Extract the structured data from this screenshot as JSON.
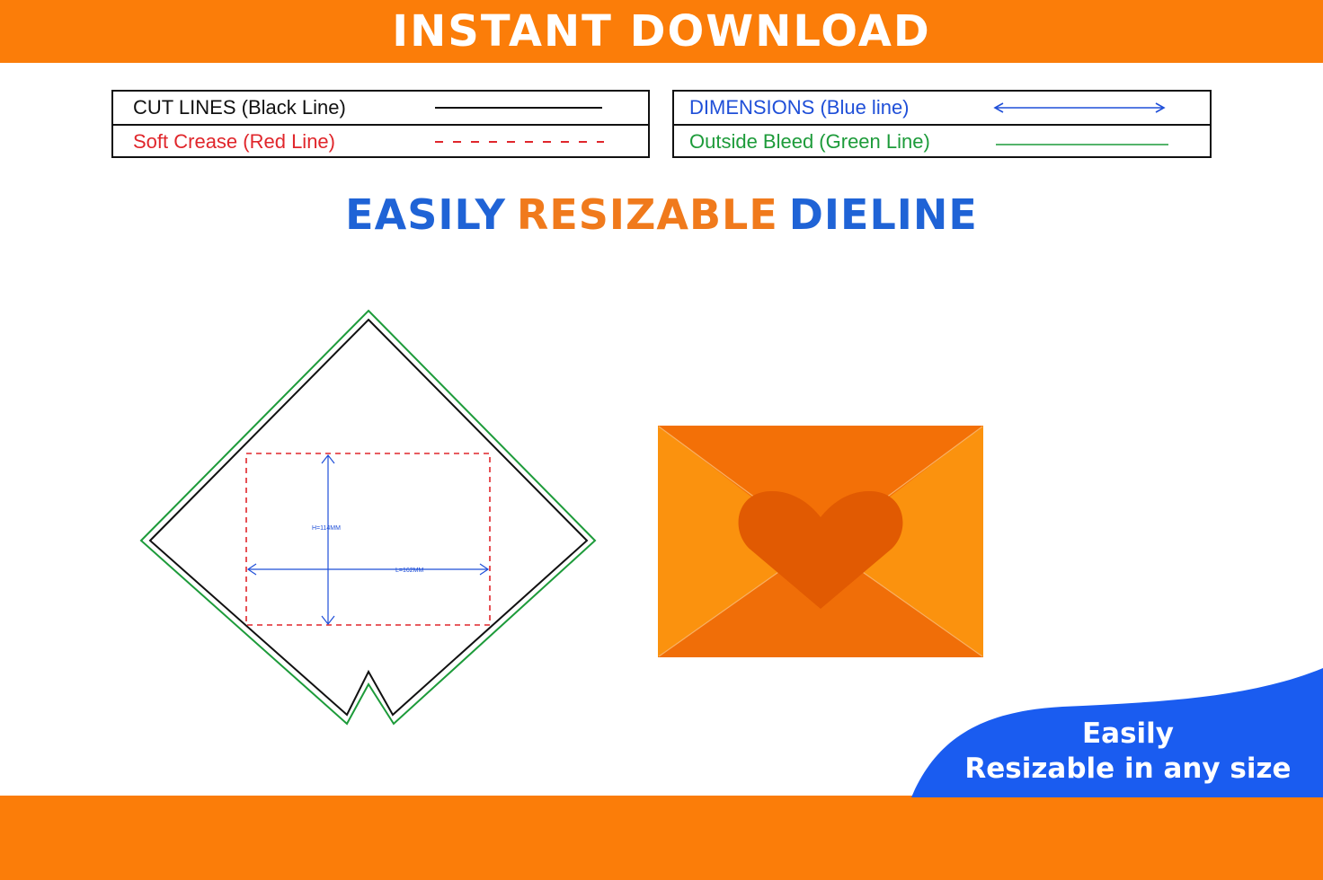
{
  "banner": {
    "title": "INSTANT DOWNLOAD"
  },
  "legend": {
    "left": [
      {
        "label": "CUT LINES (Black Line)",
        "color": "#111111",
        "style": "solid"
      },
      {
        "label": "Soft Crease (Red Line)",
        "color": "#e0262b",
        "style": "dashed"
      }
    ],
    "right": [
      {
        "label": "DIMENSIONS (Blue line)",
        "color": "#1f4fd8",
        "style": "arrow"
      },
      {
        "label": "Outside Bleed (Green Line)",
        "color": "#1d9b3a",
        "style": "solid"
      }
    ]
  },
  "headline": {
    "word1": "EASILY",
    "word2": "RESIZABLE",
    "word3": "DIELINE",
    "color_blue": "#1f63d6",
    "color_orange": "#f07a1c"
  },
  "dieline": {
    "height_label": "H=114MM",
    "length_label": "L=162MM"
  },
  "badge": {
    "line1": "Easily",
    "line2": "Resizable in any size",
    "color": "#1a5cf0"
  },
  "colors": {
    "orange": "#fb7d09",
    "envelope_body": "#f06e08",
    "envelope_side": "#fb920e",
    "heart": "#e15a02"
  }
}
